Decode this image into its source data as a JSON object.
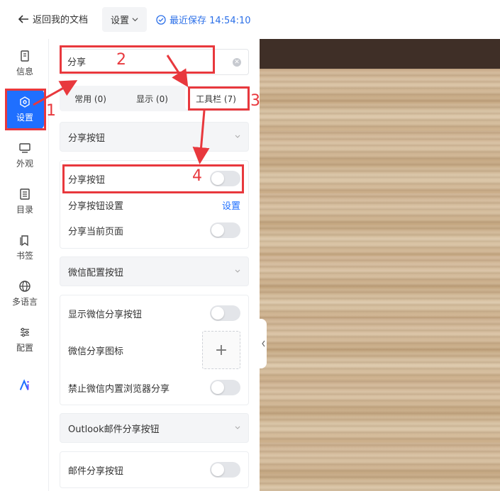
{
  "topbar": {
    "back_label": "返回我的文档",
    "settings_label": "设置",
    "saved_text": "最近保存 14:54:10"
  },
  "sidebar": {
    "items": [
      {
        "label": "信息",
        "icon": "document-icon"
      },
      {
        "label": "设置",
        "icon": "gear-hex-icon"
      },
      {
        "label": "外观",
        "icon": "monitor-icon"
      },
      {
        "label": "目录",
        "icon": "list-icon"
      },
      {
        "label": "书签",
        "icon": "bookmark-icon"
      },
      {
        "label": "多语言",
        "icon": "globe-icon"
      },
      {
        "label": "配置",
        "icon": "sliders-icon"
      }
    ],
    "active": "设置"
  },
  "panel": {
    "search_value": "分享",
    "tabs": [
      {
        "label": "常用 (0)"
      },
      {
        "label": "显示 (0)"
      },
      {
        "label": "工具栏 (7)"
      }
    ],
    "section1": {
      "title": "分享按钮",
      "rows": [
        "分享按钮",
        "分享按钮设置",
        "分享当前页面"
      ],
      "setting_link": "设置"
    },
    "section2": {
      "title": "微信配置按钮",
      "rows": [
        "显示微信分享按钮",
        "微信分享图标",
        "禁止微信内置浏览器分享"
      ]
    },
    "section3": {
      "title": "Outlook邮件分享按钮",
      "rows": [
        "邮件分享按钮"
      ]
    }
  },
  "annotations": [
    "1",
    "2",
    "3",
    "4"
  ],
  "colors": {
    "accent": "#1f6fff",
    "annotation": "#e8383d"
  }
}
